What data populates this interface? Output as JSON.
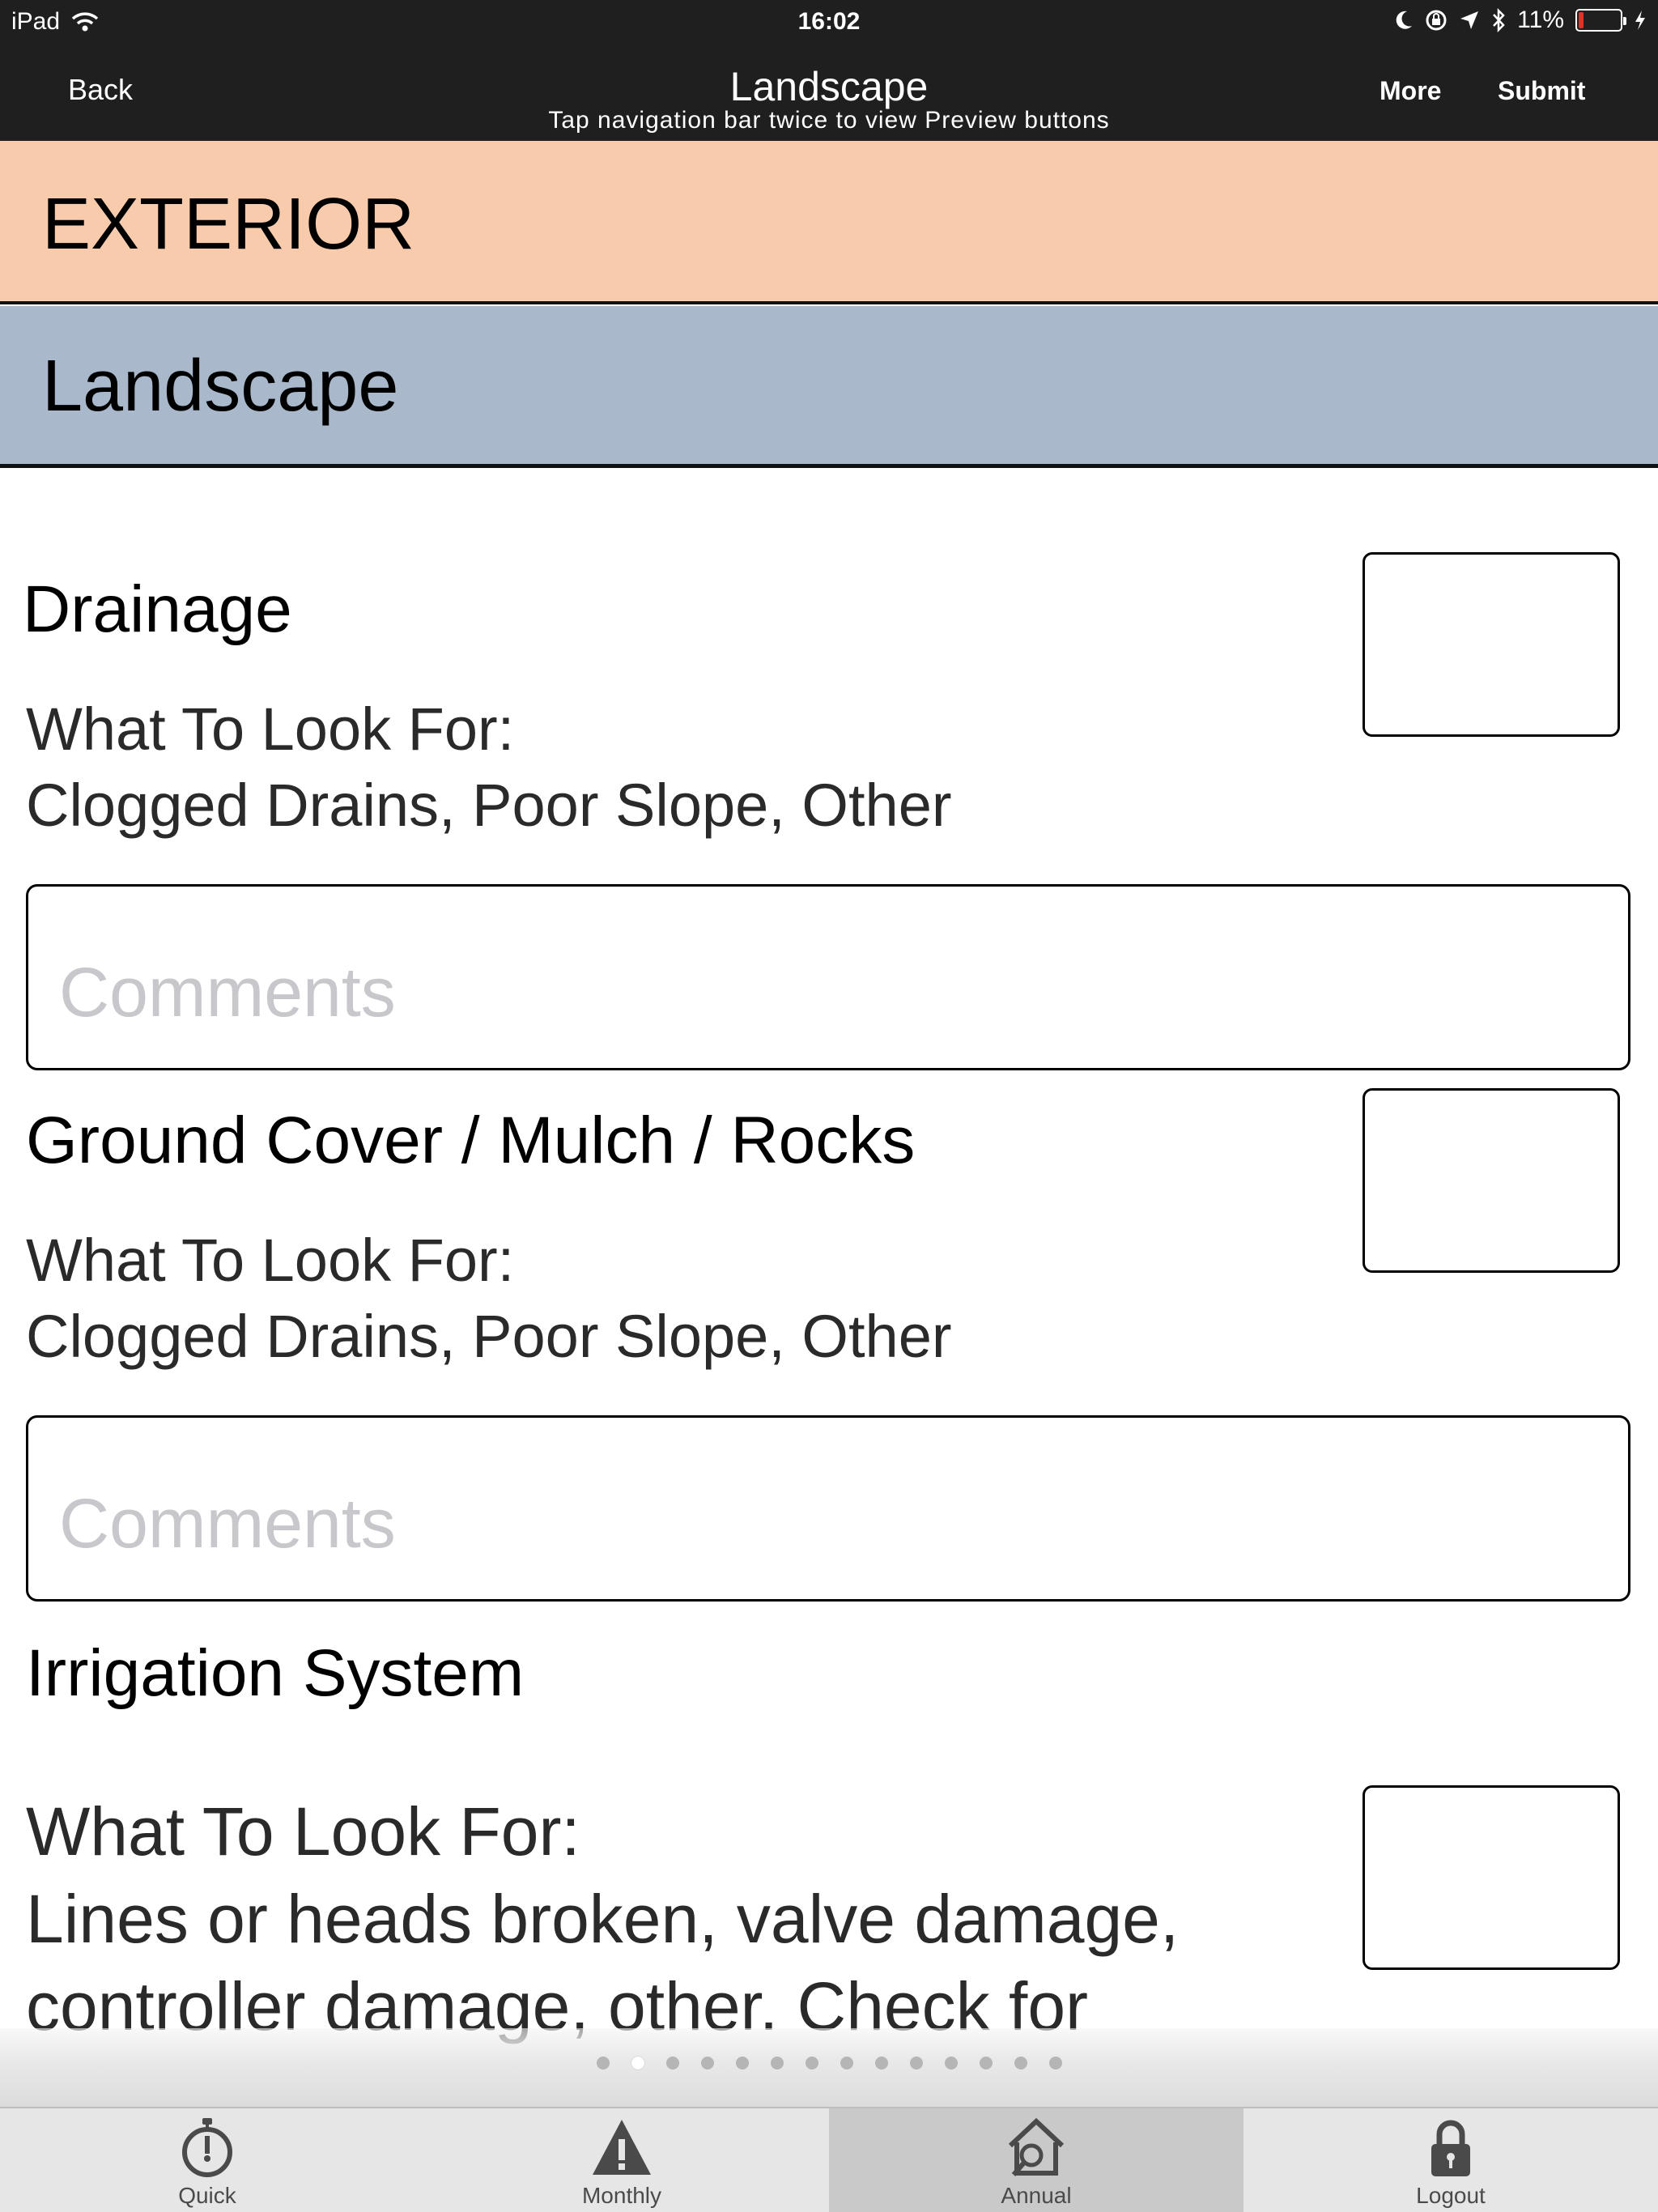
{
  "status_bar": {
    "device": "iPad",
    "time": "16:02",
    "battery_percent": "11%",
    "battery_level": 0.11
  },
  "nav": {
    "back_label": "Back",
    "title": "Landscape",
    "hint": "Tap navigation bar twice to view Preview buttons",
    "more_label": "More",
    "submit_label": "Submit"
  },
  "sections": {
    "category": "EXTERIOR",
    "subcategory": "Landscape"
  },
  "items": [
    {
      "title": "Drainage",
      "look_label": "What To Look For:",
      "look_text": "Clogged Drains, Poor Slope, Other",
      "comment_placeholder": "Comments"
    },
    {
      "title": "Ground Cover / Mulch / Rocks",
      "look_label": "What To Look For:",
      "look_text": "Clogged Drains, Poor Slope, Other",
      "comment_placeholder": "Comments"
    },
    {
      "title": "Irrigation System",
      "look_label": "What To Look For:",
      "look_text_line1": "Lines or heads broken, valve damage,",
      "look_text_line2": "controller damage, other. Check for"
    }
  ],
  "pager": {
    "total": 14,
    "active_index": 1
  },
  "tabs": [
    {
      "label": "Quick",
      "icon": "stopwatch-icon",
      "selected": false
    },
    {
      "label": "Monthly",
      "icon": "warning-icon",
      "selected": false
    },
    {
      "label": "Annual",
      "icon": "house-search-icon",
      "selected": true
    },
    {
      "label": "Logout",
      "icon": "lock-icon",
      "selected": false
    }
  ],
  "colors": {
    "bar_background": "#1f1f1f",
    "exterior_header": "#f8cbad",
    "landscape_header": "#a9b8cb",
    "battery_low": "#e0312b"
  }
}
